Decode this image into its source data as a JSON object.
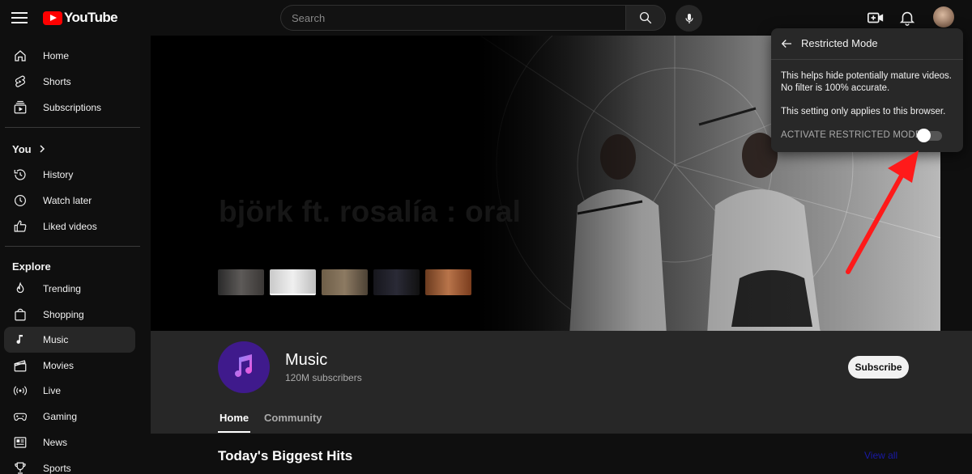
{
  "header": {
    "logo_text": "YouTube",
    "search_placeholder": "Search"
  },
  "sidebar": {
    "main": [
      {
        "label": "Home",
        "icon": "home-icon"
      },
      {
        "label": "Shorts",
        "icon": "shorts-icon"
      },
      {
        "label": "Subscriptions",
        "icon": "subscriptions-icon"
      }
    ],
    "you_title": "You",
    "you": [
      {
        "label": "History",
        "icon": "history-icon"
      },
      {
        "label": "Watch later",
        "icon": "clock-icon"
      },
      {
        "label": "Liked videos",
        "icon": "thumbs-up-icon"
      }
    ],
    "explore_title": "Explore",
    "explore": [
      {
        "label": "Trending",
        "icon": "flame-icon"
      },
      {
        "label": "Shopping",
        "icon": "shopping-bag-icon"
      },
      {
        "label": "Music",
        "icon": "music-note-icon",
        "active": true
      },
      {
        "label": "Movies",
        "icon": "clapperboard-icon"
      },
      {
        "label": "Live",
        "icon": "live-icon"
      },
      {
        "label": "Gaming",
        "icon": "gamepad-icon"
      },
      {
        "label": "News",
        "icon": "newspaper-icon"
      },
      {
        "label": "Sports",
        "icon": "trophy-icon"
      }
    ]
  },
  "banner": {
    "title": "björk ft. rosalía : oral"
  },
  "channel": {
    "name": "Music",
    "subscribers": "120M subscribers",
    "subscribe_label": "Subscribe",
    "tabs": [
      {
        "label": "Home",
        "active": true
      },
      {
        "label": "Community",
        "active": false
      }
    ]
  },
  "section": {
    "title": "Today's Biggest Hits",
    "view_all": "View all"
  },
  "restricted_popup": {
    "title": "Restricted Mode",
    "description": "This helps hide potentially mature videos. No filter is 100% accurate.",
    "note": "This setting only applies to this browser.",
    "toggle_label": "ACTIVATE RESTRICTED MODE",
    "toggle_on": false
  },
  "colors": {
    "brand_red": "#ff0000",
    "background": "#0f0f0f",
    "surface": "#272727",
    "annotation_arrow": "#ff1a1a"
  }
}
